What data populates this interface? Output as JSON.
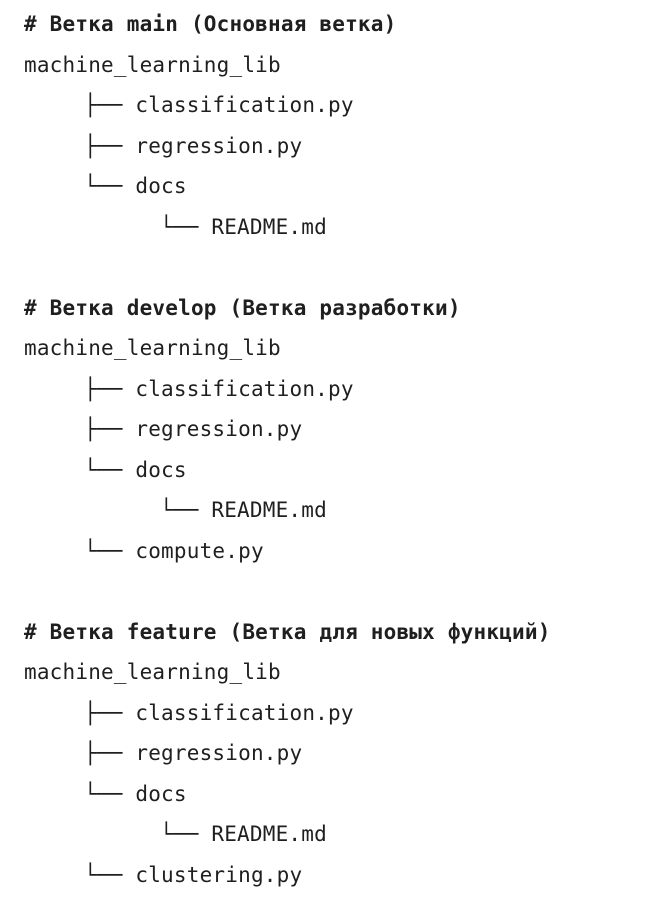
{
  "branches": [
    {
      "heading": "# Ветка main (Основная ветка)",
      "root": "machine_learning_lib",
      "entries": [
        {
          "prefix": "├── ",
          "name": "classification.py"
        },
        {
          "prefix": "├── ",
          "name": "regression.py"
        },
        {
          "prefix": "└── ",
          "name": "docs"
        },
        {
          "prefix": "└── ",
          "name": "README.md"
        }
      ]
    },
    {
      "heading": "# Ветка develop (Ветка разработки)",
      "root": "machine_learning_lib",
      "entries": [
        {
          "prefix": "├── ",
          "name": "classification.py"
        },
        {
          "prefix": "├── ",
          "name": "regression.py"
        },
        {
          "prefix": "└── ",
          "name": "docs"
        },
        {
          "prefix": "└── ",
          "name": "README.md"
        },
        {
          "prefix": "└── ",
          "name": "compute.py"
        }
      ]
    },
    {
      "heading": "# Ветка feature (Ветка для новых функций)",
      "root": "machine_learning_lib",
      "entries": [
        {
          "prefix": "├── ",
          "name": "classification.py"
        },
        {
          "prefix": "├── ",
          "name": "regression.py"
        },
        {
          "prefix": "└── ",
          "name": "docs"
        },
        {
          "prefix": "└── ",
          "name": "README.md"
        },
        {
          "prefix": "└── ",
          "name": "clustering.py"
        }
      ]
    }
  ]
}
